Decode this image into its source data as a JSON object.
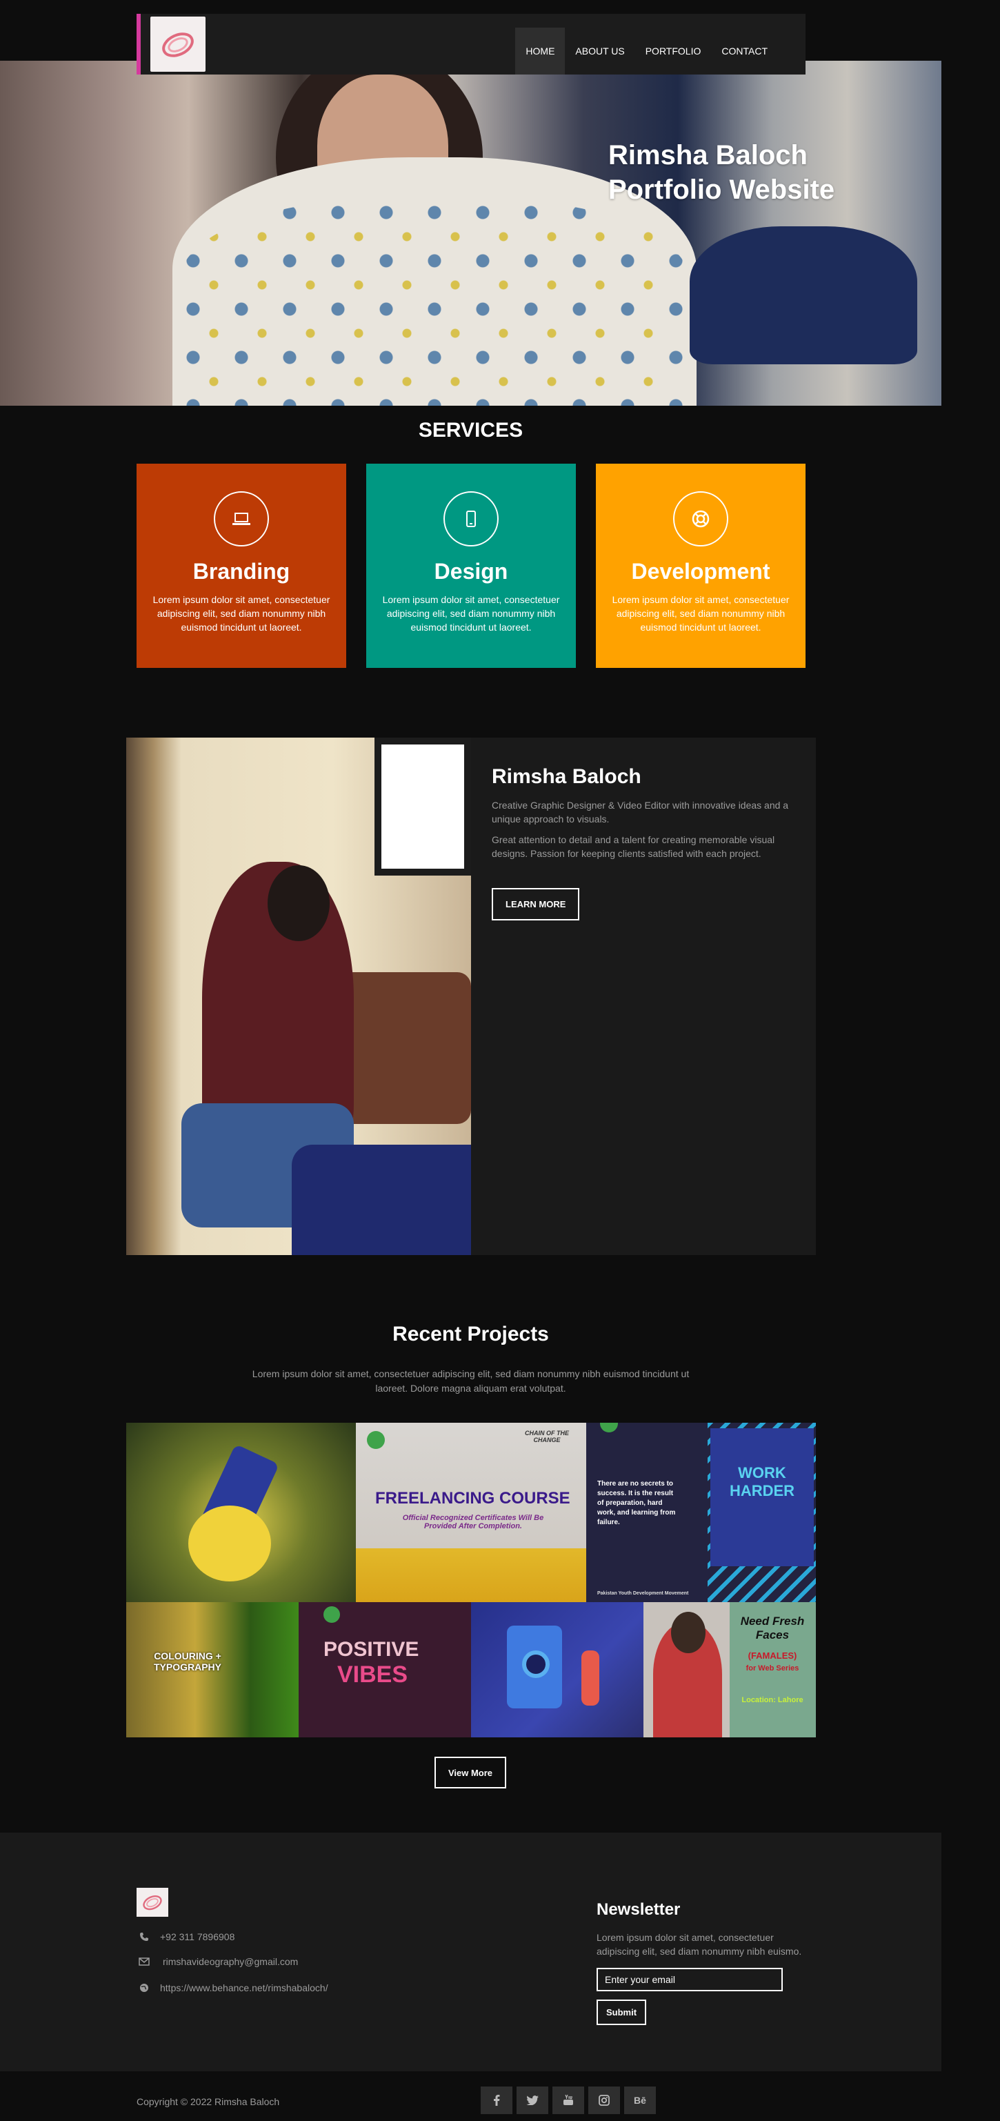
{
  "nav": {
    "items": [
      {
        "label": "HOME",
        "active": true
      },
      {
        "label": "ABOUT US",
        "active": false
      },
      {
        "label": "PORTFOLIO",
        "active": false
      },
      {
        "label": "CONTACT",
        "active": false
      }
    ],
    "accent_color": "#d53a9d"
  },
  "hero": {
    "title_line1": "Rimsha Baloch",
    "title_line2": "Portfolio Website"
  },
  "services": {
    "title": "SERVICES",
    "cards": [
      {
        "title": "Branding",
        "text": "Lorem ipsum dolor sit amet, consectetuer adipiscing elit, sed diam nonummy nibh euismod tincidunt ut laoreet.",
        "color": "#bd3b05",
        "icon": "laptop-icon"
      },
      {
        "title": "Design",
        "text": "Lorem ipsum dolor sit amet, consectetuer adipiscing elit, sed diam nonummy nibh euismod tincidunt ut laoreet.",
        "color": "#009882",
        "icon": "mobile-icon"
      },
      {
        "title": "Development",
        "text": "Lorem ipsum dolor sit amet, consectetuer adipiscing elit, sed diam nonummy nibh euismod tincidunt ut laoreet.",
        "color": "#ffa200",
        "icon": "life-ring-icon"
      }
    ]
  },
  "about": {
    "name": "Rimsha Baloch",
    "para1": "Creative Graphic Designer & Video Editor with innovative ideas and a unique approach to visuals.",
    "para2": "Great attention to detail and a talent for creating memorable visual designs. Passion for keeping clients satisfied with each project.",
    "button": "LEARN MORE"
  },
  "projects": {
    "title": "Recent Projects",
    "subtitle": "Lorem ipsum dolor sit amet, consectetuer adipiscing elit, sed diam nonummy nibh euismod tincidunt ut laoreet. Dolore magna aliquam erat volutpat.",
    "tiles": {
      "t2_label": "FREELANCING COURSE",
      "t2_sub": "Official Recognized Certificates Will Be Provided After Completion.",
      "t2_corner": "CHAIN OF THE CHANGE",
      "t3_text": "There are no secrets to success. It is the result of preparation, hard work, and learning from failure.",
      "t3_neon": "WORK HARDER",
      "t3_footer": "Pakistan Youth Development Movement",
      "t5_text": "COLOURING + TYPOGRAPHY",
      "t6_text1": "POSITIVE",
      "t6_text2": "VIBES",
      "t8_text1": "Need Fresh Faces",
      "t8_text2": "(FAMALES)",
      "t8_text3": "for Web Series",
      "t8_text4": "Location: Lahore"
    },
    "view_more": "View More"
  },
  "footer": {
    "phone": "+92 311 7896908",
    "email": "rimshavideography@gmail.com",
    "website": "https://www.behance.net/rimshabaloch/",
    "newsletter_title": "Newsletter",
    "newsletter_text": "Lorem ipsum dolor sit amet, consectetuer adipiscing elit, sed diam nonummy nibh euismo.",
    "email_placeholder": "Enter your email",
    "submit": "Submit",
    "copyright": "Copyright © 2022 Rimsha Baloch",
    "social": [
      "f",
      "twitter-icon",
      "youtube-icon",
      "instagram-icon",
      "Bē"
    ]
  }
}
